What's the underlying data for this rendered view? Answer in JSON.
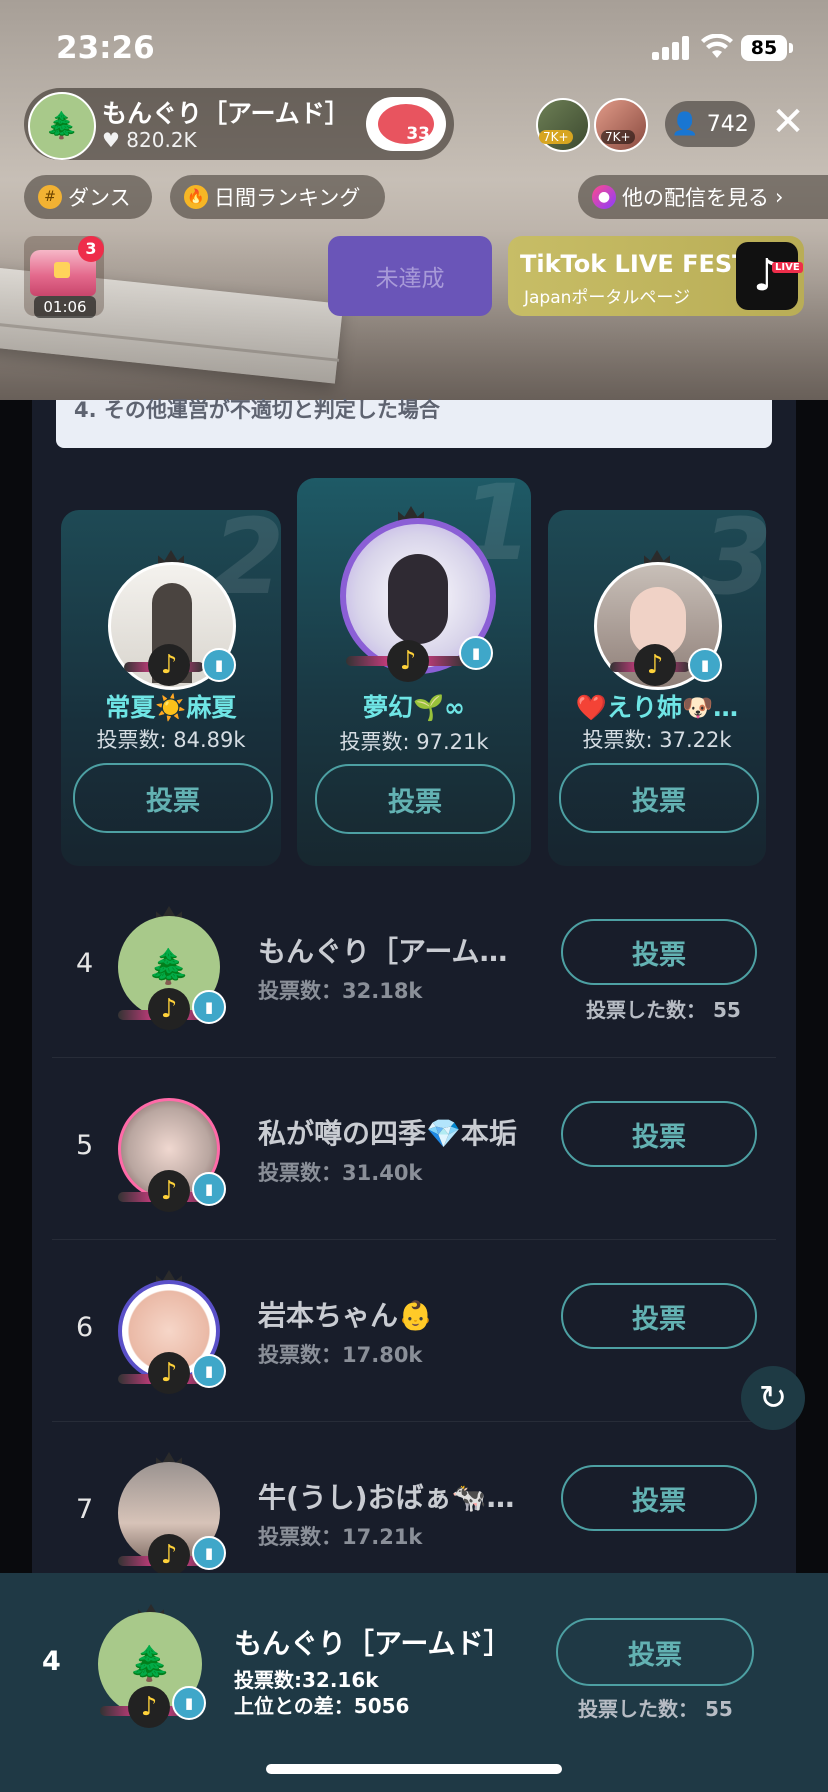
{
  "status": {
    "time": "23:26",
    "battery": "85"
  },
  "host": {
    "name": "もんぐり［アームド］",
    "likes": "820.2K",
    "heart_count": "33"
  },
  "top_gifters": [
    {
      "tag": "7K+"
    },
    {
      "tag": "7K+"
    }
  ],
  "viewers": "742",
  "chips": {
    "dance": "ダンス",
    "ranking": "日間ランキング",
    "more": "他の配信を見る"
  },
  "treasure": {
    "badge": "3",
    "timer": "01:06"
  },
  "goal_button": "未達成",
  "banner": {
    "title": "TikTok LIVE FEST",
    "subtitle": "Japanポータルページ",
    "live_tag": "LIVE"
  },
  "rules_line": "4.  その他運営が不適切と判定した場合",
  "vote_label": "投票",
  "podium": [
    {
      "rank": "2",
      "name": "常夏☀️麻夏",
      "votes": "投票数: 84.89k"
    },
    {
      "rank": "1",
      "name": "夢幻🌱∞",
      "votes": "投票数: 97.21k"
    },
    {
      "rank": "3",
      "name": "❤️えり姉🐶…",
      "votes": "投票数: 37.22k"
    }
  ],
  "list": [
    {
      "rank": "4",
      "name": "もんぐり［アーム…",
      "votes": "投票数：32.18k",
      "voted": "投票した数： 55"
    },
    {
      "rank": "5",
      "name": "私が噂の四季💎本垢",
      "votes": "投票数：31.40k"
    },
    {
      "rank": "6",
      "name": "岩本ちゃん👶",
      "votes": "投票数：17.80k"
    },
    {
      "rank": "7",
      "name": "牛(うし)おばぁ🐄…",
      "votes": "投票数：17.21k"
    }
  ],
  "me": {
    "rank": "4",
    "name": "もんぐり［アームド］",
    "votes": "投票数:32.16k",
    "diff": "上位との差：5056",
    "voted": "投票した数： 55"
  },
  "colors": {
    "accent_cyan": "#6fe5e5",
    "vote_border": "#4da0a3",
    "panel_bg": "#181d2a",
    "bottom_bar": "#1f3945"
  }
}
